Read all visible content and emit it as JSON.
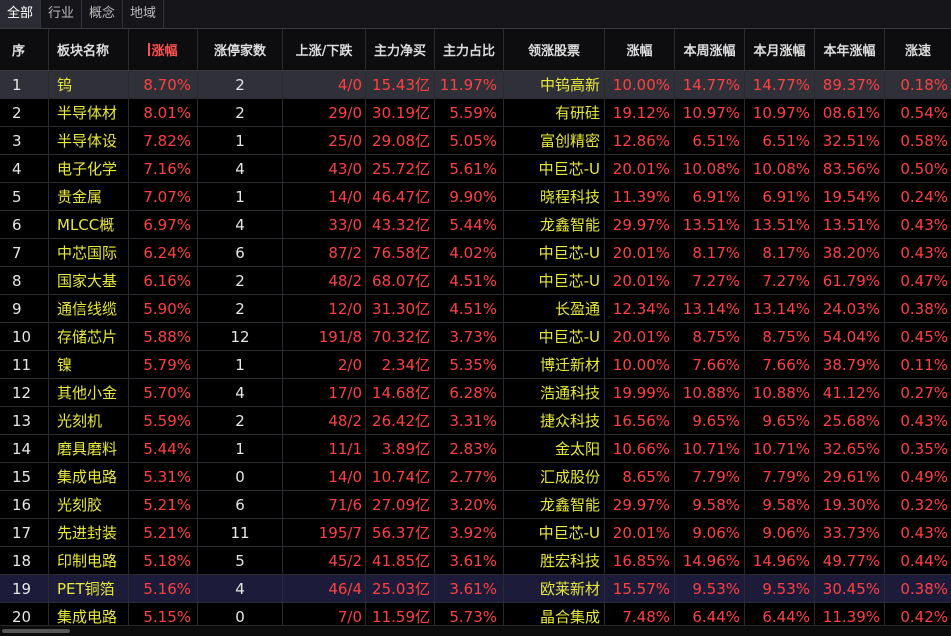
{
  "tabs": [
    {
      "label": "全部",
      "active": true
    },
    {
      "label": "行业",
      "active": false
    },
    {
      "label": "概念",
      "active": false
    },
    {
      "label": "地域",
      "active": false
    }
  ],
  "columns": {
    "seq": "序",
    "name": "板块名称",
    "change": "涨幅",
    "limit_up": "涨停家数",
    "up_down": "上涨/下跌",
    "net_buy": "主力净买",
    "main_ratio": "主力占比",
    "leader": "领涨股票",
    "leader_change": "涨幅",
    "week": "本周涨幅",
    "month": "本月涨幅",
    "year": "本年涨幅",
    "speed": "涨速"
  },
  "colors": {
    "up": "#ff4040",
    "name": "#e8e83a",
    "selected_row": "#303038",
    "highlight_row": "#1c1c3a"
  },
  "rows": [
    {
      "seq": "1",
      "name": "钨",
      "change": "8.70%",
      "limit_up": "2",
      "up_down": "4/0",
      "net_buy": "15.43亿",
      "main_ratio": "11.97%",
      "leader": "中钨高新",
      "leader_change": "10.00%",
      "week": "14.77%",
      "month": "14.77%",
      "year": "89.37%",
      "speed": "0.18%"
    },
    {
      "seq": "2",
      "name": "半导体材",
      "change": "8.01%",
      "limit_up": "2",
      "up_down": "29/0",
      "net_buy": "30.19亿",
      "main_ratio": "5.59%",
      "leader": "有研硅",
      "leader_change": "19.12%",
      "week": "10.97%",
      "month": "10.97%",
      "year": "08.61%",
      "speed": "0.54%"
    },
    {
      "seq": "3",
      "name": "半导体设",
      "change": "7.82%",
      "limit_up": "1",
      "up_down": "25/0",
      "net_buy": "29.08亿",
      "main_ratio": "5.05%",
      "leader": "富创精密",
      "leader_change": "12.86%",
      "week": "6.51%",
      "month": "6.51%",
      "year": "32.51%",
      "speed": "0.58%"
    },
    {
      "seq": "4",
      "name": "电子化学",
      "change": "7.16%",
      "limit_up": "4",
      "up_down": "43/0",
      "net_buy": "25.72亿",
      "main_ratio": "5.61%",
      "leader": "中巨芯-U",
      "leader_change": "20.01%",
      "week": "10.08%",
      "month": "10.08%",
      "year": "83.56%",
      "speed": "0.50%"
    },
    {
      "seq": "5",
      "name": "贵金属",
      "change": "7.07%",
      "limit_up": "1",
      "up_down": "14/0",
      "net_buy": "46.47亿",
      "main_ratio": "9.90%",
      "leader": "晓程科技",
      "leader_change": "11.39%",
      "week": "6.91%",
      "month": "6.91%",
      "year": "19.54%",
      "speed": "0.24%"
    },
    {
      "seq": "6",
      "name": "MLCC概",
      "change": "6.97%",
      "limit_up": "4",
      "up_down": "33/0",
      "net_buy": "43.32亿",
      "main_ratio": "5.44%",
      "leader": "龙鑫智能",
      "leader_change": "29.97%",
      "week": "13.51%",
      "month": "13.51%",
      "year": "13.51%",
      "speed": "0.43%"
    },
    {
      "seq": "7",
      "name": "中芯国际",
      "change": "6.24%",
      "limit_up": "6",
      "up_down": "87/2",
      "net_buy": "76.58亿",
      "main_ratio": "4.02%",
      "leader": "中巨芯-U",
      "leader_change": "20.01%",
      "week": "8.17%",
      "month": "8.17%",
      "year": "38.20%",
      "speed": "0.43%"
    },
    {
      "seq": "8",
      "name": "国家大基",
      "change": "6.16%",
      "limit_up": "2",
      "up_down": "48/2",
      "net_buy": "68.07亿",
      "main_ratio": "4.51%",
      "leader": "中巨芯-U",
      "leader_change": "20.01%",
      "week": "7.27%",
      "month": "7.27%",
      "year": "61.79%",
      "speed": "0.47%"
    },
    {
      "seq": "9",
      "name": "通信线缆",
      "change": "5.90%",
      "limit_up": "2",
      "up_down": "12/0",
      "net_buy": "31.30亿",
      "main_ratio": "4.51%",
      "leader": "长盈通",
      "leader_change": "12.34%",
      "week": "13.14%",
      "month": "13.14%",
      "year": "24.03%",
      "speed": "0.38%"
    },
    {
      "seq": "10",
      "name": "存储芯片",
      "change": "5.88%",
      "limit_up": "12",
      "up_down": "191/8",
      "net_buy": "70.32亿",
      "main_ratio": "3.73%",
      "leader": "中巨芯-U",
      "leader_change": "20.01%",
      "week": "8.75%",
      "month": "8.75%",
      "year": "54.04%",
      "speed": "0.45%"
    },
    {
      "seq": "11",
      "name": "镍",
      "change": "5.79%",
      "limit_up": "1",
      "up_down": "2/0",
      "net_buy": "2.34亿",
      "main_ratio": "5.35%",
      "leader": "博迁新材",
      "leader_change": "10.00%",
      "week": "7.66%",
      "month": "7.66%",
      "year": "38.79%",
      "speed": "0.11%"
    },
    {
      "seq": "12",
      "name": "其他小金",
      "change": "5.70%",
      "limit_up": "4",
      "up_down": "17/0",
      "net_buy": "14.68亿",
      "main_ratio": "6.28%",
      "leader": "浩通科技",
      "leader_change": "19.99%",
      "week": "10.88%",
      "month": "10.88%",
      "year": "41.12%",
      "speed": "0.27%"
    },
    {
      "seq": "13",
      "name": "光刻机",
      "change": "5.59%",
      "limit_up": "2",
      "up_down": "48/2",
      "net_buy": "26.42亿",
      "main_ratio": "3.31%",
      "leader": "捷众科技",
      "leader_change": "16.56%",
      "week": "9.65%",
      "month": "9.65%",
      "year": "25.68%",
      "speed": "0.43%"
    },
    {
      "seq": "14",
      "name": "磨具磨料",
      "change": "5.44%",
      "limit_up": "1",
      "up_down": "11/1",
      "net_buy": "3.89亿",
      "main_ratio": "2.83%",
      "leader": "金太阳",
      "leader_change": "10.66%",
      "week": "10.71%",
      "month": "10.71%",
      "year": "32.65%",
      "speed": "0.35%"
    },
    {
      "seq": "15",
      "name": "集成电路",
      "change": "5.31%",
      "limit_up": "0",
      "up_down": "14/0",
      "net_buy": "10.74亿",
      "main_ratio": "2.77%",
      "leader": "汇成股份",
      "leader_change": "8.65%",
      "week": "7.79%",
      "month": "7.79%",
      "year": "29.61%",
      "speed": "0.49%"
    },
    {
      "seq": "16",
      "name": "光刻胶",
      "change": "5.21%",
      "limit_up": "6",
      "up_down": "71/6",
      "net_buy": "27.09亿",
      "main_ratio": "3.20%",
      "leader": "龙鑫智能",
      "leader_change": "29.97%",
      "week": "9.58%",
      "month": "9.58%",
      "year": "19.30%",
      "speed": "0.32%"
    },
    {
      "seq": "17",
      "name": "先进封装",
      "change": "5.21%",
      "limit_up": "11",
      "up_down": "195/7",
      "net_buy": "56.37亿",
      "main_ratio": "3.92%",
      "leader": "中巨芯-U",
      "leader_change": "20.01%",
      "week": "9.06%",
      "month": "9.06%",
      "year": "33.73%",
      "speed": "0.43%"
    },
    {
      "seq": "18",
      "name": "印制电路",
      "change": "5.18%",
      "limit_up": "5",
      "up_down": "45/2",
      "net_buy": "41.85亿",
      "main_ratio": "3.61%",
      "leader": "胜宏科技",
      "leader_change": "16.85%",
      "week": "14.96%",
      "month": "14.96%",
      "year": "49.77%",
      "speed": "0.44%"
    },
    {
      "seq": "19",
      "name": "PET铜箔",
      "change": "5.16%",
      "limit_up": "4",
      "up_down": "46/4",
      "net_buy": "25.03亿",
      "main_ratio": "3.61%",
      "leader": "欧莱新材",
      "leader_change": "15.57%",
      "week": "9.53%",
      "month": "9.53%",
      "year": "30.45%",
      "speed": "0.38%"
    },
    {
      "seq": "20",
      "name": "集成电路",
      "change": "5.15%",
      "limit_up": "0",
      "up_down": "7/0",
      "net_buy": "11.59亿",
      "main_ratio": "5.73%",
      "leader": "晶合集成",
      "leader_change": "7.48%",
      "week": "6.44%",
      "month": "6.44%",
      "year": "11.39%",
      "speed": "0.42%"
    }
  ]
}
